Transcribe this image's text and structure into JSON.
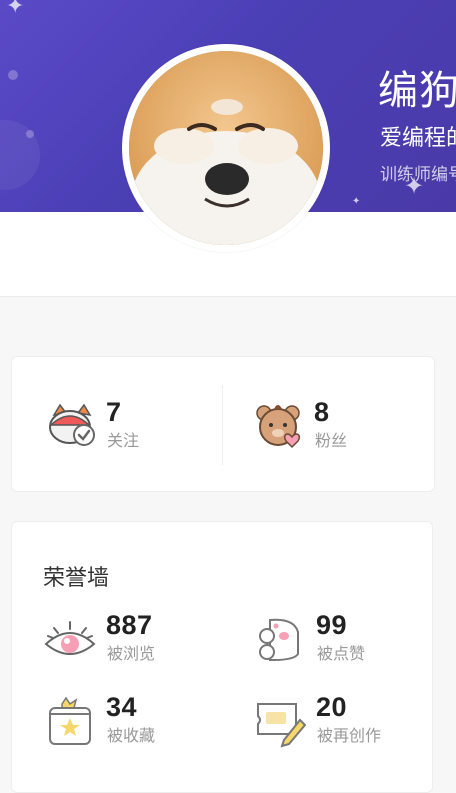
{
  "profile": {
    "name": "编狗",
    "tagline": "爱编程的",
    "trainer_id": "训练师编号"
  },
  "social": {
    "following": {
      "count": "7",
      "label": "关注",
      "icon": "cat-check-icon"
    },
    "fans": {
      "count": "8",
      "label": "粉丝",
      "icon": "bear-heart-icon"
    }
  },
  "honor_wall": {
    "title": "荣誉墙",
    "items": [
      {
        "count": "887",
        "label": "被浏览",
        "icon": "eye-icon"
      },
      {
        "count": "99",
        "label": "被点赞",
        "icon": "paw-like-icon"
      },
      {
        "count": "34",
        "label": "被收藏",
        "icon": "star-box-icon"
      },
      {
        "count": "20",
        "label": "被再创作",
        "icon": "pencil-card-icon"
      }
    ]
  },
  "colors": {
    "banner": "#4b3fb5",
    "accent_red": "#ee5a5a",
    "accent_pink": "#f7a0b5",
    "accent_yellow": "#f7d66a"
  }
}
